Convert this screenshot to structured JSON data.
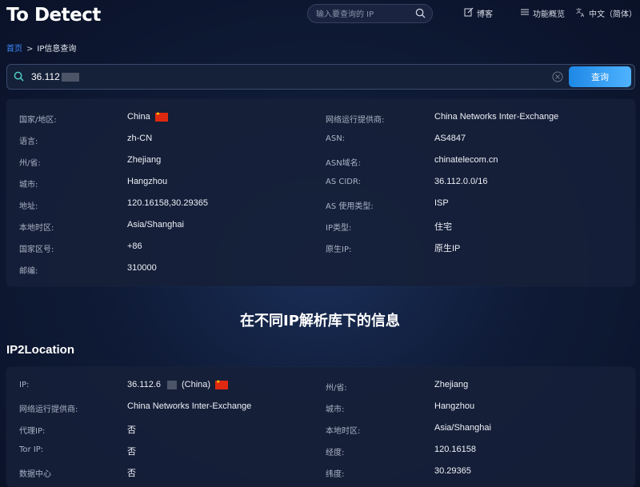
{
  "header": {
    "logo": "To Detect",
    "search_placeholder": "输入要查询的 IP",
    "nav": [
      {
        "label": "博客",
        "icon": "edit-icon"
      },
      {
        "label": "功能概览",
        "icon": "menu-icon"
      },
      {
        "label": "中文（简体）",
        "icon": "translate-icon"
      }
    ]
  },
  "breadcrumb": {
    "home": "首页",
    "separator": ">",
    "current": "IP信息查询"
  },
  "search": {
    "value": "36.112",
    "button": "查询"
  },
  "info": {
    "left": [
      {
        "label": "国家/地区:",
        "value": "China",
        "flag": true
      },
      {
        "label": "语言:",
        "value": "zh-CN"
      },
      {
        "label": "州/省:",
        "value": "Zhejiang"
      },
      {
        "label": "城市:",
        "value": "Hangzhou"
      },
      {
        "label": "地址:",
        "value": "120.16158,30.29365"
      },
      {
        "label": "本地时区:",
        "value": "Asia/Shanghai"
      },
      {
        "label": "国家区号:",
        "value": "+86"
      },
      {
        "label": "邮编:",
        "value": "310000"
      }
    ],
    "right": [
      {
        "label": "网络运行提供商:",
        "value": "China Networks Inter-Exchange"
      },
      {
        "label": "ASN:",
        "value": "AS4847"
      },
      {
        "label": "ASN域名:",
        "value": "chinatelecom.cn"
      },
      {
        "label": "AS CIDR:",
        "value": "36.112.0.0/16"
      },
      {
        "label": "AS 使用类型:",
        "value": "ISP"
      },
      {
        "label": "IP类型:",
        "value": "住宅"
      },
      {
        "label": "原生IP:",
        "value": "原生IP"
      }
    ]
  },
  "section_title": "在不同IP解析库下的信息",
  "ip2location": {
    "title": "IP2Location",
    "left": [
      {
        "label": "IP:",
        "value": "36.112.6",
        "suffix": "(China)",
        "flag": true
      },
      {
        "label": "网络运行提供商:",
        "value": "China Networks Inter-Exchange"
      },
      {
        "label": "代理IP:",
        "value": "否"
      },
      {
        "label": "Tor IP:",
        "value": "否"
      },
      {
        "label": "数据中心",
        "value": "否"
      }
    ],
    "right": [
      {
        "label": "州/省:",
        "value": "Zhejiang"
      },
      {
        "label": "城市:",
        "value": "Hangzhou"
      },
      {
        "label": "本地时区:",
        "value": "Asia/Shanghai"
      },
      {
        "label": "经度:",
        "value": "120.16158"
      },
      {
        "label": "纬度:",
        "value": "30.29365"
      }
    ]
  },
  "colors": {
    "accent": "#3d8bff",
    "button": "#2b93f0",
    "background": "#0f1b37"
  }
}
